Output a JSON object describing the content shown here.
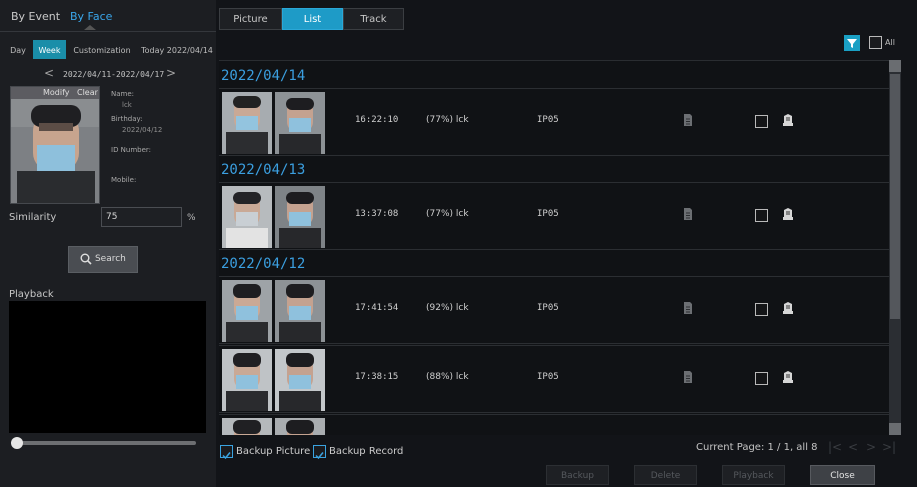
{
  "nav": {
    "by_event": "By Event",
    "by_face": "By Face"
  },
  "range_tabs": {
    "day": "Day",
    "week": "Week",
    "customization": "Customization",
    "today": "Today 2022/04/14"
  },
  "week_range": "2022/04/11-2022/04/17",
  "face": {
    "modify": "Modify",
    "clear": "Clear",
    "name_label": "Name:",
    "name_value": "lck",
    "birthday_label": "Birthday:",
    "birthday_value": "2022/04/12",
    "id_label": "ID Number:",
    "mobile_label": "Mobile:"
  },
  "similarity": {
    "label": "Similarity",
    "value": "75",
    "unit": "%"
  },
  "search_button": "Search",
  "playback": {
    "label": "Playback",
    "progress": 0
  },
  "view_tabs": {
    "picture": "Picture",
    "list": "List",
    "track": "Track"
  },
  "all_label": "All",
  "groups": [
    {
      "date": "2022/04/14",
      "records": [
        {
          "time": "16:22:10",
          "match": "(77%) lck",
          "camera": "IP05"
        }
      ]
    },
    {
      "date": "2022/04/13",
      "records": [
        {
          "time": "13:37:08",
          "match": "(77%) lck",
          "camera": "IP05"
        }
      ]
    },
    {
      "date": "2022/04/12",
      "records": [
        {
          "time": "17:41:54",
          "match": "(92%) lck",
          "camera": "IP05"
        },
        {
          "time": "17:38:15",
          "match": "(88%) lck",
          "camera": "IP05"
        }
      ]
    }
  ],
  "options": {
    "backup_picture": "Backup Picture",
    "backup_record": "Backup Record"
  },
  "page_info": "Current Page: 1 / 1, all 8",
  "buttons": {
    "backup": "Backup",
    "delete": "Delete",
    "playback": "Playback",
    "close": "Close"
  },
  "colors": {
    "accent": "#1e9bc7",
    "date_header": "#3b9fe0",
    "selected_tab": "#1a8ea9"
  }
}
